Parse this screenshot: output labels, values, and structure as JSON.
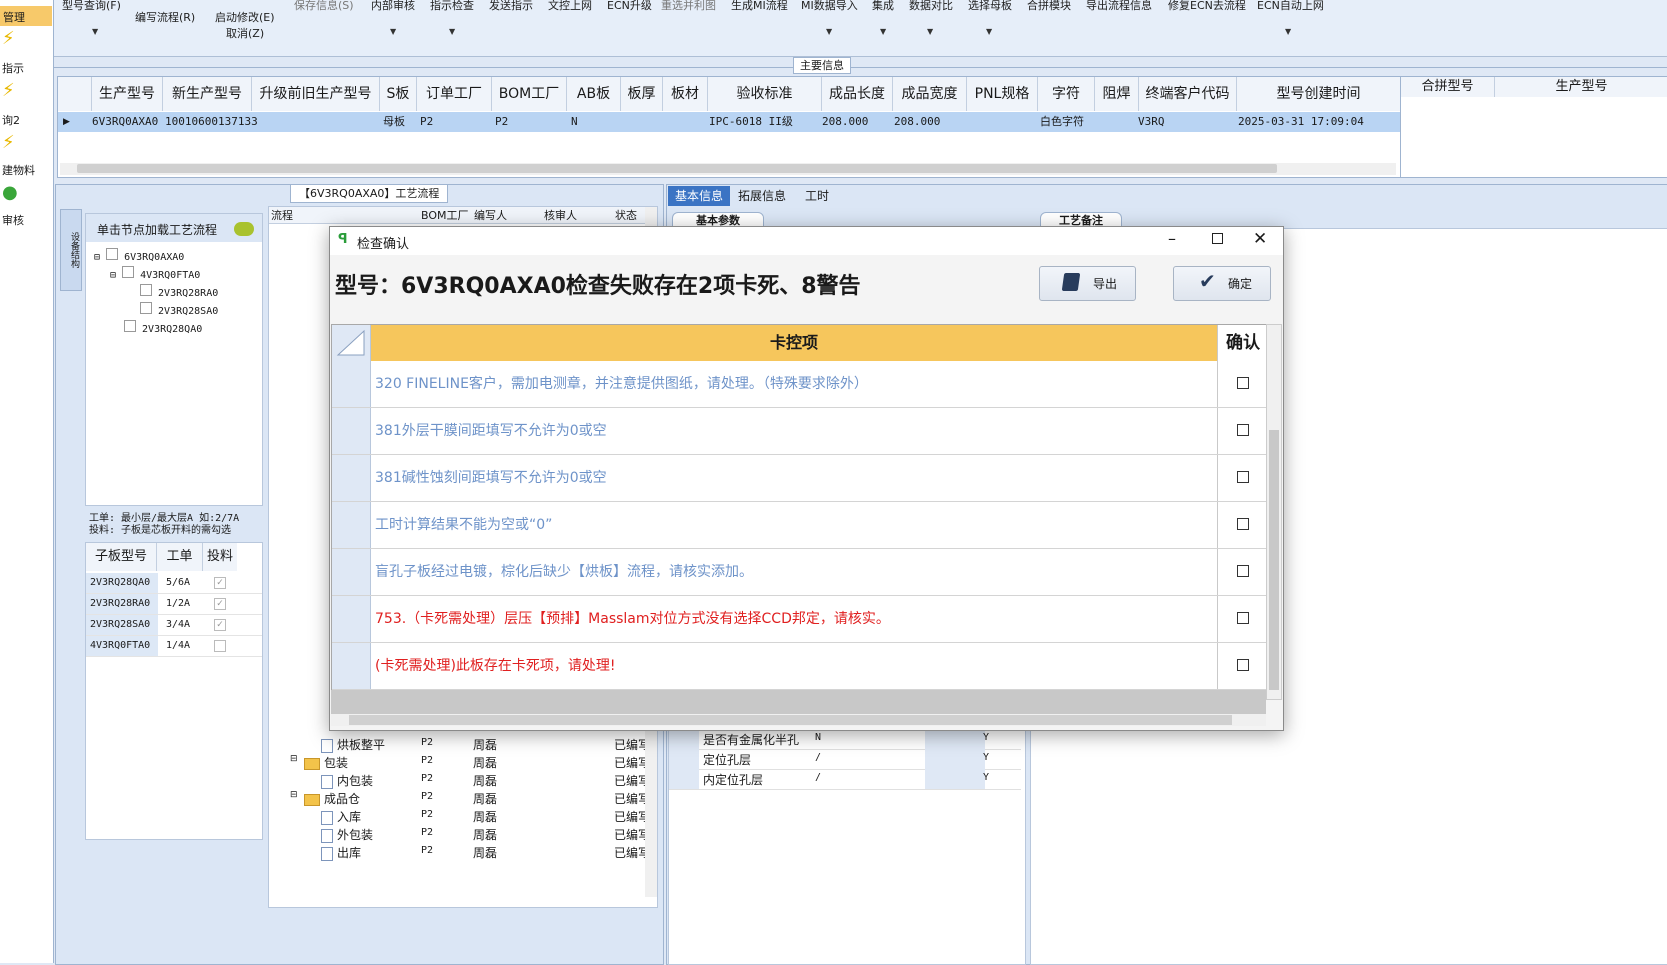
{
  "left_nav": {
    "items": [
      {
        "label": "管理",
        "icon": "lightning-icon"
      },
      {
        "label": "指示",
        "icon": "lightning-icon"
      },
      {
        "label": "询2",
        "icon": "lightning-icon"
      },
      {
        "label": "建物料",
        "icon": "lightning-icon"
      },
      {
        "label": "审核",
        "icon": "check-icon"
      }
    ]
  },
  "ribbon": {
    "row1": [
      "型号查询(F)",
      "保存信息(S)",
      "内部审核",
      "指示检查",
      "发送指示",
      "文控上网",
      "ECN升级",
      "重选并利图",
      "生成MI流程",
      "MI数据导入",
      "集成",
      "数据对比",
      "选择母板",
      "合拼模块",
      "导出流程信息",
      "修复ECN去流程",
      "ECN自动上网"
    ],
    "edit_flow": "编写流程(R)",
    "start_modify": "启动修改(E)",
    "cancel": "取消(Z)",
    "main_info": "主要信息"
  },
  "top_grid": {
    "headers": [
      "生产型号",
      "新生产型号",
      "升级前旧生产型号",
      "S板",
      "订单工厂",
      "BOM工厂",
      "AB板",
      "板厚",
      "板材",
      "验收标准",
      "成品长度",
      "成品宽度",
      "PNL规格",
      "字符",
      "阻焊",
      "终端客户代码",
      "型号创建时间"
    ],
    "row": [
      "6V3RQ0AXA0",
      "10010600137133",
      "",
      "母板",
      "P2",
      "P2",
      "N",
      "",
      "",
      "IPC-6018 II级",
      "208.000",
      "208.000",
      "",
      "白色字符",
      "",
      "V3RQ",
      "2025-03-31 17:09:04"
    ],
    "right_headers": [
      "合拼型号",
      "生产型号"
    ]
  },
  "process_panel": {
    "title": "【6V3RQ0AXA0】工艺流程",
    "side_tab": "设备结构",
    "hint": "单击节点加载工艺流程",
    "tree": [
      "6V3RQ0AXA0",
      "4V3RQ0FTA0",
      "2V3RQ28RA0",
      "2V3RQ28SA0",
      "2V3RQ28QA0"
    ],
    "work_note1": "工单: 最小层/最大层A 如:2/7A",
    "work_note2": "投料: 子板是芯板开料的需勾选",
    "sub_headers": [
      "子板型号",
      "工单",
      "投料"
    ],
    "sub_rows": [
      {
        "model": "2V3RQ28QA0",
        "order": "5/6A",
        "feed": true
      },
      {
        "model": "2V3RQ28RA0",
        "order": "1/2A",
        "feed": true
      },
      {
        "model": "2V3RQ28SA0",
        "order": "3/4A",
        "feed": true
      },
      {
        "model": "4V3RQ0FTA0",
        "order": "1/4A",
        "feed": false
      }
    ]
  },
  "flow_grid": {
    "headers": [
      "流程",
      "BOM工厂",
      "编写人",
      "核审人",
      "状态"
    ],
    "rows": [
      {
        "name": "烘板整平",
        "type": "doc",
        "factory": "P2",
        "writer": "周磊",
        "status": "已编写"
      },
      {
        "name": "包装",
        "type": "folder",
        "factory": "P2",
        "writer": "周磊",
        "status": "已编写"
      },
      {
        "name": "内包装",
        "type": "doc",
        "factory": "P2",
        "writer": "周磊",
        "status": "已编写"
      },
      {
        "name": "成品仓",
        "type": "folder",
        "factory": "P2",
        "writer": "周磊",
        "status": "已编写"
      },
      {
        "name": "入库",
        "type": "doc",
        "factory": "P2",
        "writer": "周磊",
        "status": "已编写"
      },
      {
        "name": "外包装",
        "type": "doc",
        "factory": "P2",
        "writer": "周磊",
        "status": "已编写"
      },
      {
        "name": "出库",
        "type": "doc",
        "factory": "P2",
        "writer": "周磊",
        "status": "已编写"
      }
    ]
  },
  "info_panel": {
    "tabs": [
      "基本信息",
      "拓展信息",
      "工时"
    ],
    "sub_tab": "基本参数",
    "remark_tab": "工艺备注",
    "rows": [
      {
        "name": "是否有金属化半孔",
        "value": "N",
        "flag": "Y"
      },
      {
        "name": "定位孔层",
        "value": "/",
        "flag": "Y"
      },
      {
        "name": "内定位孔层",
        "value": "/",
        "flag": "Y"
      }
    ]
  },
  "dialog": {
    "title": "检查确认",
    "heading": "型号：6V3RQ0AXA0检查失败存在2项卡死、8警告",
    "export_label": "导出",
    "ok_label": "确定",
    "col_item": "卡控项",
    "col_confirm": "确认",
    "rows": [
      {
        "text": "320 FINELINE客户，需加电测章，并注意提供图纸，请处理。（特殊要求除外）",
        "level": "warn"
      },
      {
        "text": "381外层干膜间距填写不允许为0或空",
        "level": "warn"
      },
      {
        "text": "381碱性蚀刻间距填写不允许为0或空",
        "level": "warn"
      },
      {
        "text": "工时计算结果不能为空或“0”",
        "level": "warn"
      },
      {
        "text": "盲孔子板经过电镀，棕化后缺少【烘板】流程，请核实添加。",
        "level": "warn"
      },
      {
        "text": "753.（卡死需处理）层压【预排】Masslam对位方式没有选择CCD邦定，请核实。",
        "level": "block"
      },
      {
        "text": "(卡死需处理)此板存在卡死项，请处理!",
        "level": "block"
      }
    ],
    "colors": {
      "warn": "#6e93c9",
      "block": "#e02020",
      "header_bg": "#f6c65c"
    }
  }
}
